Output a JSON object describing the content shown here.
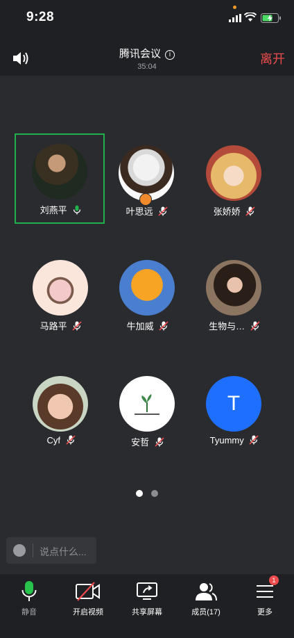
{
  "status_bar": {
    "time": "9:28"
  },
  "meeting": {
    "title": "腾讯会议",
    "info_icon": "i",
    "duration": "35:04",
    "leave_label": "离开"
  },
  "participants": [
    {
      "name": "刘燕平",
      "mic": "on",
      "active": true,
      "avatar": "photo-man"
    },
    {
      "name": "叶思远",
      "mic": "muted",
      "host": true,
      "avatar": "cartoon-sketch"
    },
    {
      "name": "张娇娇",
      "mic": "muted",
      "avatar": "anime-girl"
    },
    {
      "name": "马路平",
      "mic": "muted",
      "avatar": "piggy-cartoon"
    },
    {
      "name": "牛加威",
      "mic": "muted",
      "avatar": "garfield"
    },
    {
      "name": "生物与…",
      "mic": "muted",
      "avatar": "photo-woman"
    },
    {
      "name": "Cyf",
      "mic": "muted",
      "avatar": "photo-kid"
    },
    {
      "name": "安哲",
      "mic": "muted",
      "avatar": "sprout-logo"
    },
    {
      "name": "Tyummy",
      "mic": "muted",
      "avatar": "letter",
      "letter": "T"
    }
  ],
  "pager": {
    "pages": 2,
    "current": 1
  },
  "chat": {
    "placeholder": "说点什么..."
  },
  "toolbar": {
    "mute": "静音",
    "video": "开启视频",
    "share": "共享屏幕",
    "members": "成员(17)",
    "more": "更多",
    "more_badge": "1"
  },
  "colors": {
    "accent_green": "#20b24d",
    "leave_red": "#ef4d4d",
    "avatar_blue": "#1f6fff"
  }
}
